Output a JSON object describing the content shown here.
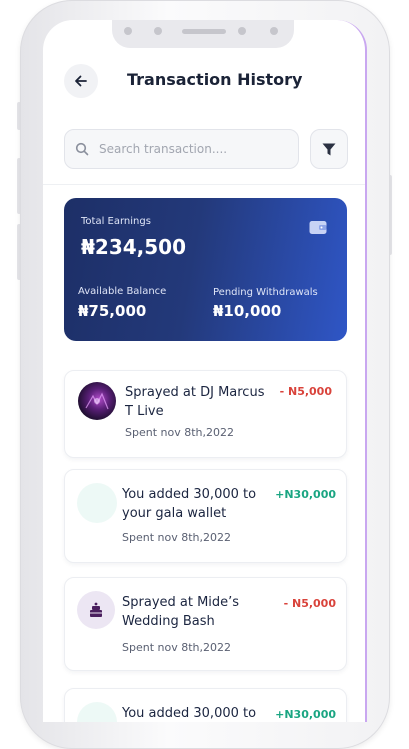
{
  "header": {
    "title": "Transaction History"
  },
  "search": {
    "placeholder": "Search transaction...."
  },
  "earnings": {
    "total_label": "Total Earnings",
    "total_value": "₦234,500",
    "available_label": "Available Balance",
    "available_value": "₦75,000",
    "pending_label": "Pending Withdrawals",
    "pending_value": "₦10,000"
  },
  "transactions": [
    {
      "title": "Sprayed at DJ Marcus T Live",
      "amount": "- N5,000",
      "date": "Spent nov 8th,2022",
      "type": "debit"
    },
    {
      "title": "You added 30,000 to your gala       wallet",
      "amount": "+N30,000",
      "date": "Spent nov 8th,2022",
      "type": "credit"
    },
    {
      "title": "Sprayed at Mide’s Wedding Bash",
      "amount": "- N5,000",
      "date": "Spent nov 8th,2022",
      "type": "debit"
    },
    {
      "title": "You added 30,000 to",
      "amount": "+N30,000",
      "date": "",
      "type": "credit"
    }
  ],
  "icons": {
    "back": "arrow-left-icon",
    "search": "search-icon",
    "filter": "filter-icon",
    "wallet": "wallet-icon"
  },
  "colors": {
    "card_start": "#1d2f67",
    "card_end": "#2f56c6",
    "debit": "#d9433b",
    "credit": "#1aa582",
    "text_dark": "#1b2337"
  }
}
